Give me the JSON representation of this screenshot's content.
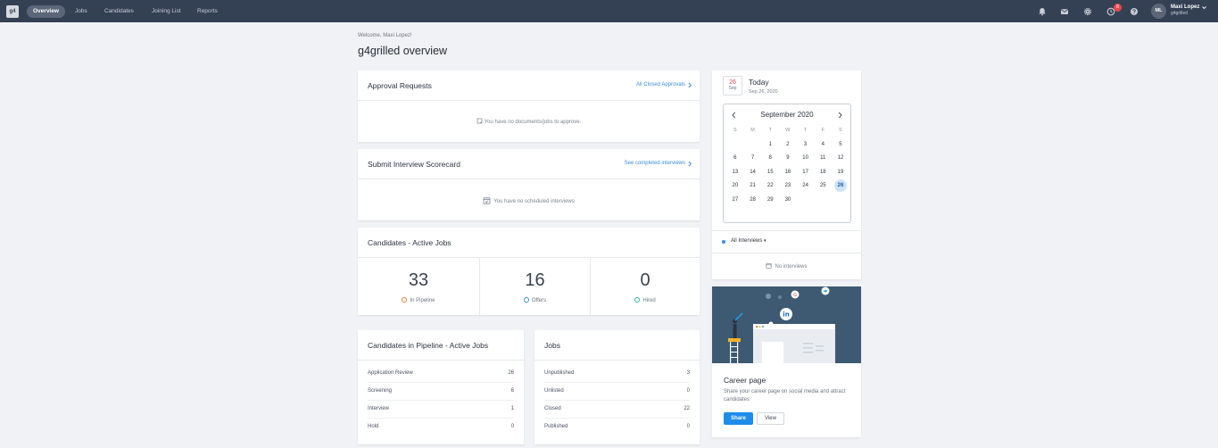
{
  "nav": {
    "logo": "g4",
    "items": [
      "Overview",
      "Jobs",
      "Candidates",
      "Joining List",
      "Reports"
    ],
    "notification_count": "8",
    "user": {
      "initials": "ML",
      "name": "Maxi Lopez",
      "org": "g4grilled"
    }
  },
  "header": {
    "welcome": "Welcome, Maxi Lopez!",
    "title": "g4grilled overview"
  },
  "approval": {
    "title": "Approval Requests",
    "link": "All Closed Approvals",
    "empty": "You have no documents/jobs to approve."
  },
  "scorecard": {
    "title": "Submit Interview Scorecard",
    "link": "See completed interviews",
    "empty": "You have no scheduled interviews"
  },
  "active_jobs": {
    "title": "Candidates - Active Jobs",
    "stats": [
      {
        "value": "33",
        "label": "In Pipeline",
        "color": "#e8883a"
      },
      {
        "value": "16",
        "label": "Offers",
        "color": "#3c8ddb"
      },
      {
        "value": "0",
        "label": "Hired",
        "color": "#2fb58f"
      }
    ]
  },
  "pipeline": {
    "title": "Candidates in Pipeline - Active Jobs",
    "rows": [
      {
        "label": "Application Review",
        "value": "26"
      },
      {
        "label": "Screening",
        "value": "6"
      },
      {
        "label": "Interview",
        "value": "1"
      },
      {
        "label": "Hold",
        "value": "0"
      }
    ]
  },
  "jobs": {
    "title": "Jobs",
    "rows": [
      {
        "label": "Unpublished",
        "value": "3"
      },
      {
        "label": "Unlisted",
        "value": "0"
      },
      {
        "label": "Closed",
        "value": "22"
      },
      {
        "label": "Published",
        "value": "0"
      }
    ]
  },
  "calendar": {
    "day": "26",
    "month_short": "Sep",
    "today_label": "Today",
    "today_date": "Sep 26, 2020",
    "month_title": "September 2020",
    "weekdays": [
      "S",
      "M",
      "T",
      "W",
      "T",
      "F",
      "S"
    ],
    "days": [
      "",
      "",
      "1",
      "2",
      "3",
      "4",
      "5",
      "6",
      "7",
      "8",
      "9",
      "10",
      "11",
      "12",
      "13",
      "14",
      "15",
      "16",
      "17",
      "18",
      "19",
      "20",
      "21",
      "22",
      "23",
      "24",
      "25",
      "26",
      "27",
      "28",
      "29",
      "30",
      "",
      "",
      ""
    ],
    "selected": "26",
    "interviews_filter": "All Interviews",
    "no_interviews": "No interviews"
  },
  "career": {
    "title": "Career page",
    "desc": "Share your career page on social media and attract candidates",
    "share": "Share",
    "view": "View"
  },
  "colors": {
    "nav_bg": "#344054",
    "accent": "#3c8ddb",
    "primary_button": "#1d8cea",
    "hero_bg": "#3e5a73"
  }
}
